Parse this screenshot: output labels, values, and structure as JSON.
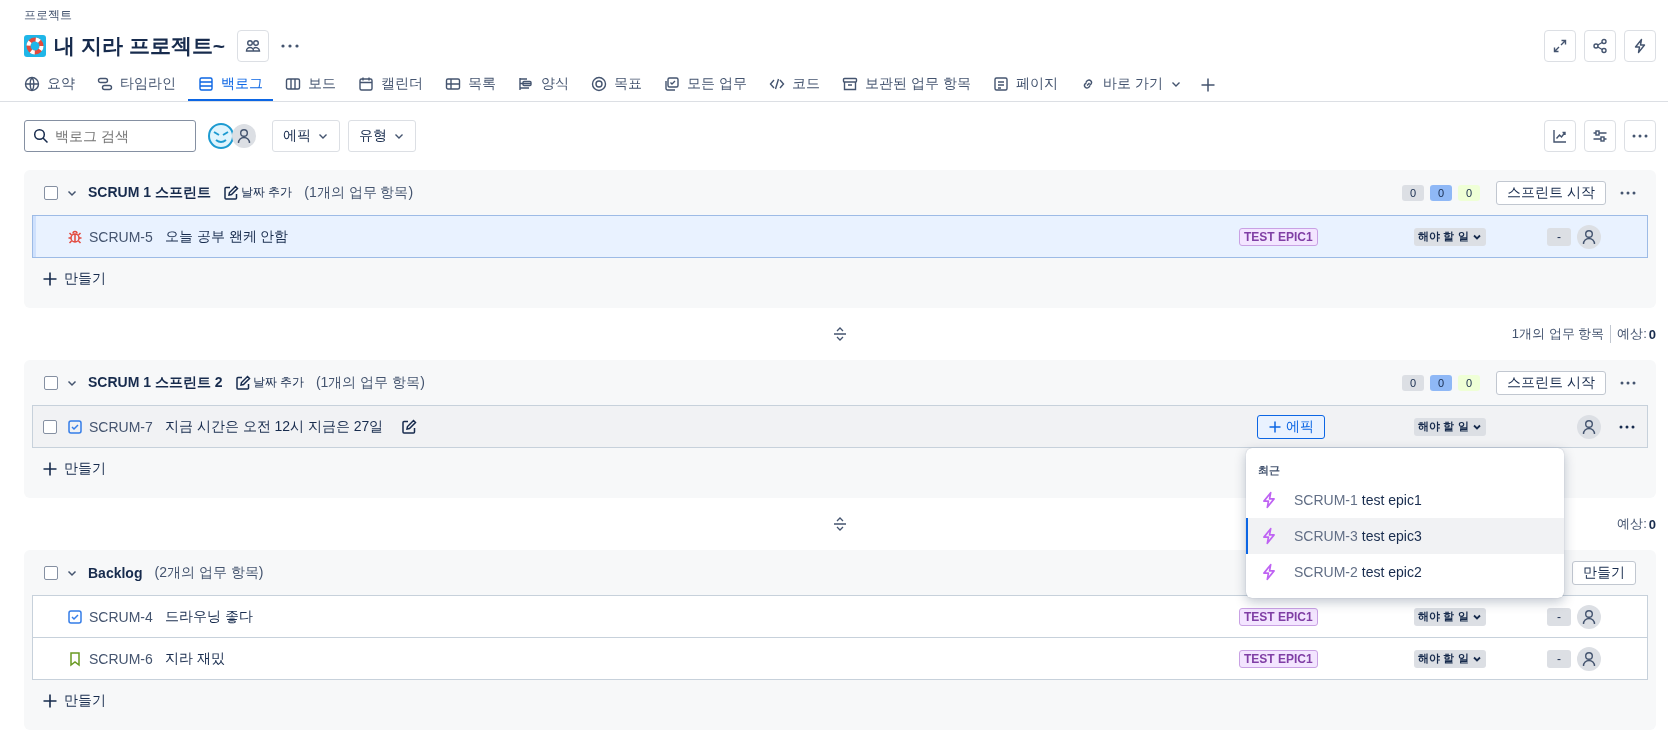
{
  "breadcrumb": "프로젝트",
  "project": {
    "title": "내 지라 프로젝트~"
  },
  "tabs": [
    {
      "label": "요약",
      "selected": false
    },
    {
      "label": "타임라인",
      "selected": false
    },
    {
      "label": "백로그",
      "selected": true
    },
    {
      "label": "보드",
      "selected": false
    },
    {
      "label": "캘린더",
      "selected": false
    },
    {
      "label": "목록",
      "selected": false
    },
    {
      "label": "양식",
      "selected": false
    },
    {
      "label": "목표",
      "selected": false
    },
    {
      "label": "모든 업무",
      "selected": false
    },
    {
      "label": "코드",
      "selected": false
    },
    {
      "label": "보관된 업무 항목",
      "selected": false
    },
    {
      "label": "페이지",
      "selected": false
    },
    {
      "label": "바로 가기",
      "selected": false
    }
  ],
  "toolbar": {
    "search": {
      "placeholder": "백로그 검색"
    },
    "filters": [
      "에픽",
      "유형"
    ]
  },
  "sprints": [
    {
      "title": "SCRUM 1 스프린트",
      "date_label": "날짜 추가",
      "count": "(1개의 업무 항목)",
      "checked": false,
      "expanded": true,
      "counters": [
        {
          "value": "0",
          "color": "#dcdfe4"
        },
        {
          "value": "0",
          "color": "#8fb8f6"
        },
        {
          "value": "0",
          "color": "#efffd6"
        }
      ],
      "button": "스프린트 시작",
      "issues": [
        {
          "kind": "bug",
          "key": "SCRUM-5",
          "summary": "오늘 공부 왠케 안함",
          "epic": "TEST EPIC1",
          "status": "해야 할 일",
          "estimate": "-",
          "selected": true,
          "hovered": false
        }
      ],
      "create": "만들기",
      "footer": {
        "count": "1개의 업무 항목",
        "estimate_label": "예상:",
        "estimate": "0"
      }
    },
    {
      "title": "SCRUM 1 스프린트 2",
      "date_label": "날짜 추가",
      "count": "(1개의 업무 항목)",
      "checked": false,
      "expanded": true,
      "counters": [
        {
          "value": "0",
          "color": "#dcdfe4"
        },
        {
          "value": "0",
          "color": "#8fb8f6"
        },
        {
          "value": "0",
          "color": "#efffd6"
        }
      ],
      "button": "스프린트 시작",
      "issues": [
        {
          "kind": "task",
          "key": "SCRUM-7",
          "summary": "지금 시간은 오전 12시 지금은 27일",
          "epic_button": "에픽",
          "status": "해야 할 일",
          "selected": false,
          "hovered": true,
          "checked": false
        }
      ],
      "epic_menu": {
        "heading": "최근",
        "items": [
          {
            "key": "SCRUM-1",
            "name": "test epic1",
            "selected": false
          },
          {
            "key": "SCRUM-3",
            "name": "test epic3",
            "selected": true
          },
          {
            "key": "SCRUM-2",
            "name": "test epic2",
            "selected": false
          }
        ]
      },
      "create": "만들기",
      "footer": {
        "estimate_label": "예상:",
        "estimate": "0"
      }
    }
  ],
  "backlog": {
    "title": "Backlog",
    "count": "(2개의 업무 항목)",
    "checked": false,
    "expanded": true,
    "button": "만들기",
    "issues": [
      {
        "kind": "task",
        "key": "SCRUM-4",
        "summary": "드라우닝 좋다",
        "epic": "TEST EPIC1",
        "status": "해야 할 일",
        "estimate": "-",
        "selected": false,
        "hovered": false
      },
      {
        "kind": "story",
        "key": "SCRUM-6",
        "summary": "지라 재밌",
        "epic": "TEST EPIC1",
        "status": "해야 할 일",
        "estimate": "-",
        "selected": false,
        "hovered": false
      }
    ],
    "create": "만들기"
  }
}
